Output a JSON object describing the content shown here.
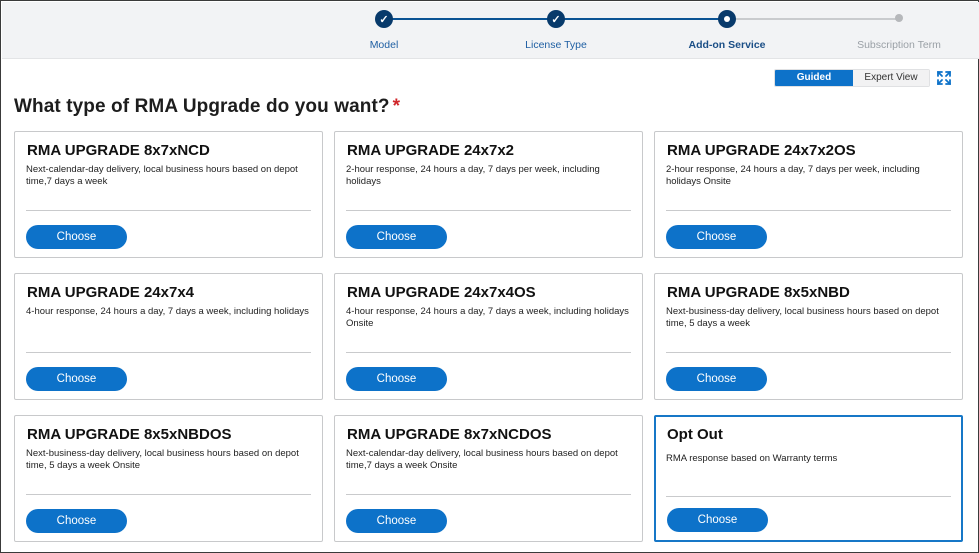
{
  "stepper": {
    "steps": [
      {
        "label": "Model",
        "state": "done"
      },
      {
        "label": "License Type",
        "state": "done"
      },
      {
        "label": "Add-on Service",
        "state": "current"
      },
      {
        "label": "Subscription Term",
        "state": "future"
      }
    ]
  },
  "view_toggle": {
    "guided_label": "Guided View",
    "expert_label": "Expert View",
    "selected": "Guided View"
  },
  "question": {
    "text": "What type of RMA Upgrade do you want?",
    "required_mark": "*"
  },
  "options": [
    {
      "title": "RMA UPGRADE 8x7xNCD",
      "description": "Next-calendar-day delivery, local business hours based on depot time,7 days a week",
      "button": "Choose"
    },
    {
      "title": "RMA UPGRADE 24x7x2",
      "description": "2-hour response, 24 hours a day, 7 days per week, including holidays",
      "button": "Choose"
    },
    {
      "title": "RMA UPGRADE 24x7x2OS",
      "description": "2-hour response, 24 hours a day, 7 days per week, including holidays Onsite",
      "button": "Choose"
    },
    {
      "title": "RMA UPGRADE 24x7x4",
      "description": "4-hour response, 24 hours a day, 7 days a week, including holidays",
      "button": "Choose"
    },
    {
      "title": "RMA UPGRADE 24x7x4OS",
      "description": "4-hour response, 24 hours a day, 7 days a week, including holidays Onsite",
      "button": "Choose"
    },
    {
      "title": "RMA UPGRADE 8x5xNBD",
      "description": "Next-business-day delivery, local business hours based on depot time, 5 days a week",
      "button": "Choose"
    },
    {
      "title": "RMA UPGRADE 8x5xNBDOS",
      "description": "Next-business-day delivery, local business hours based on depot time, 5 days a week Onsite",
      "button": "Choose"
    },
    {
      "title": "RMA UPGRADE 8x7xNCDOS",
      "description": "Next-calendar-day delivery, local business hours based on depot time,7 days a week Onsite",
      "button": "Choose"
    },
    {
      "title": "Opt Out",
      "description": "RMA response based on Warranty terms",
      "button": "Choose",
      "selected": true
    }
  ],
  "colors": {
    "primary": "#0d72c9",
    "stepper_dot": "#083a6b",
    "required": "#d0262a"
  }
}
